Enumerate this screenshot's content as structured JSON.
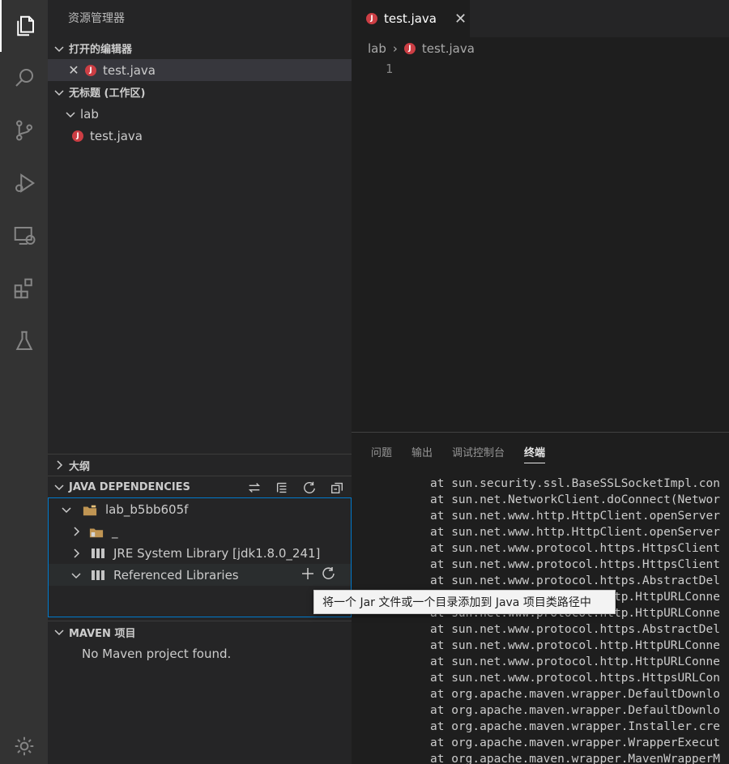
{
  "activity_bar": {
    "items": [
      {
        "name": "explorer-icon",
        "active": true
      },
      {
        "name": "search-icon"
      },
      {
        "name": "source-control-icon"
      },
      {
        "name": "run-debug-icon"
      },
      {
        "name": "remote-explorer-icon"
      },
      {
        "name": "extensions-icon"
      },
      {
        "name": "testing-icon"
      },
      {
        "name": "settings-gear-icon"
      }
    ]
  },
  "sidebar": {
    "title": "资源管理器",
    "open_editors": {
      "header": "打开的编辑器",
      "items": [
        {
          "label": "test.java"
        }
      ]
    },
    "workspace": {
      "header": "无标题 (工作区)",
      "folder": "lab",
      "files": [
        {
          "label": "test.java"
        }
      ]
    },
    "outline": {
      "header": "大纲"
    },
    "java_dependencies": {
      "header": "JAVA DEPENDENCIES",
      "project": "lab_b5bb605f",
      "items": [
        {
          "label": "_"
        },
        {
          "label": "JRE System Library [jdk1.8.0_241]"
        },
        {
          "label": "Referenced Libraries"
        }
      ],
      "tooltip": "将一个 Jar 文件或一个目录添加到 Java 项目类路径中"
    },
    "maven": {
      "header": "MAVEN 项目",
      "empty_text": "No Maven project found."
    }
  },
  "editor": {
    "tab": {
      "label": "test.java"
    },
    "breadcrumb": {
      "folder": "lab",
      "file": "test.java"
    },
    "line_number": "1"
  },
  "panel": {
    "tabs": [
      "问题",
      "输出",
      "调试控制台",
      "终端"
    ],
    "active_tab": "终端",
    "terminal_lines": [
      "at sun.security.ssl.BaseSSLSocketImpl.con",
      "at sun.net.NetworkClient.doConnect(Networ",
      "at sun.net.www.http.HttpClient.openServer",
      "at sun.net.www.http.HttpClient.openServer",
      "at sun.net.www.protocol.https.HttpsClient",
      "at sun.net.www.protocol.https.HttpsClient",
      "at sun.net.www.protocol.https.AbstractDel",
      "at sun.net.www.protocol.http.HttpURLConne",
      "at sun.net.www.protocol.http.HttpURLConne",
      "at sun.net.www.protocol.https.AbstractDel",
      "at sun.net.www.protocol.http.HttpURLConne",
      "at sun.net.www.protocol.http.HttpURLConne",
      "at sun.net.www.protocol.https.HttpsURLCon",
      "at org.apache.maven.wrapper.DefaultDownlo",
      "at org.apache.maven.wrapper.DefaultDownlo",
      "at org.apache.maven.wrapper.Installer.cre",
      "at org.apache.maven.wrapper.WrapperExecut",
      "at org.apache.maven.wrapper.MavenWrapperM"
    ]
  }
}
